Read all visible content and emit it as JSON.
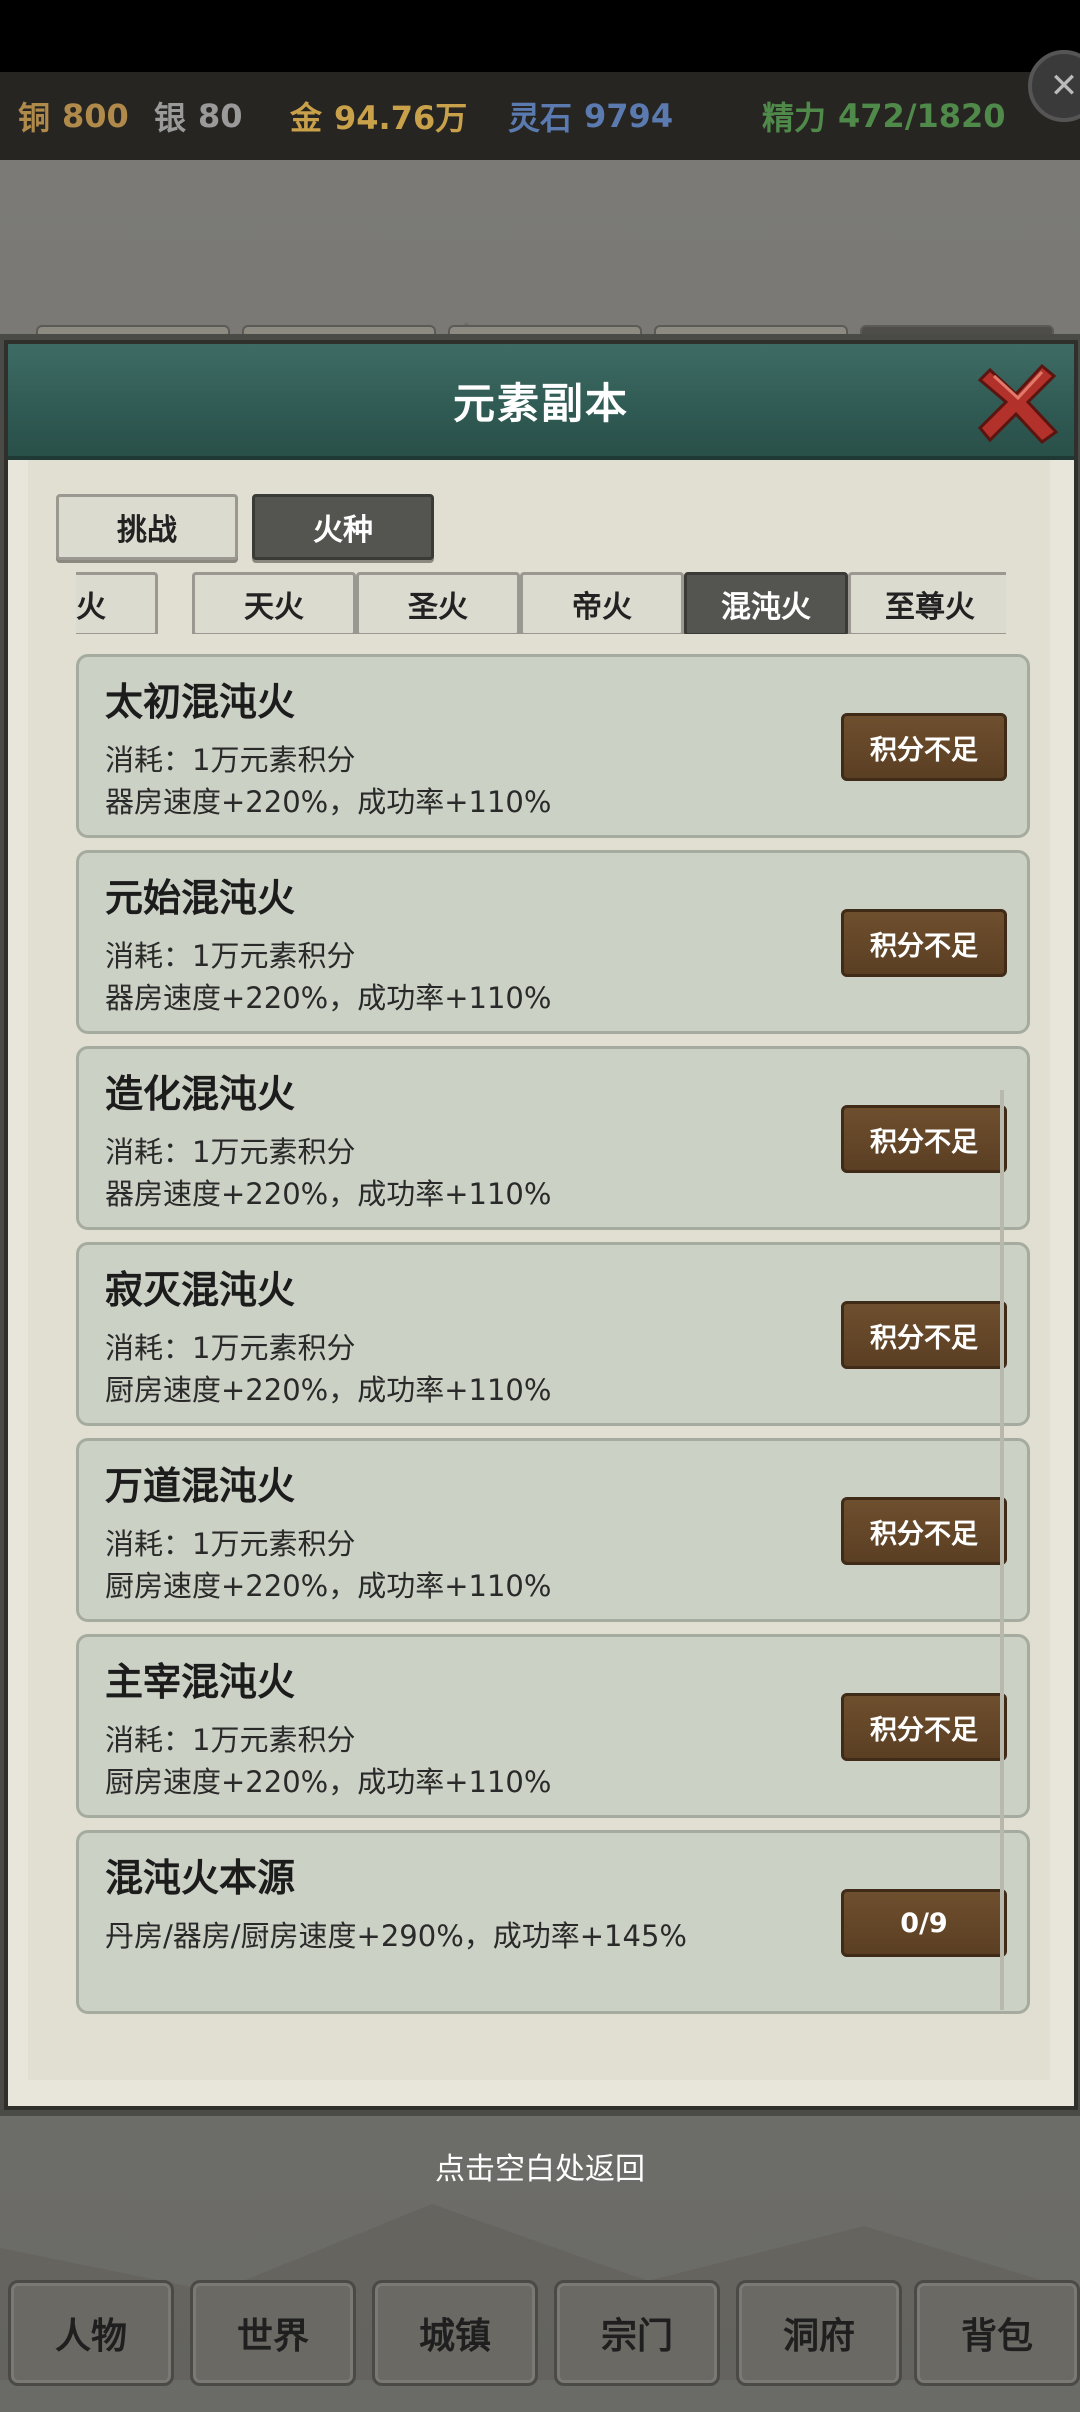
{
  "topbar": {
    "copper_label": "铜",
    "copper_value": "800",
    "silver_label": "银",
    "silver_value": "80",
    "gold_label": "金",
    "gold_value": "94.76万",
    "spirit_label": "灵石",
    "spirit_value": "9794",
    "energy_label": "精力",
    "energy_value": "472/1820"
  },
  "modal": {
    "title": "元素副本"
  },
  "content_tabs": [
    {
      "label": "挑战",
      "active": false
    },
    {
      "label": "火种",
      "active": true
    }
  ],
  "fire_tabs": [
    {
      "label": "地火",
      "active": false
    },
    {
      "label": "天火",
      "active": false
    },
    {
      "label": "圣火",
      "active": false
    },
    {
      "label": "帝火",
      "active": false
    },
    {
      "label": "混沌火",
      "active": true
    },
    {
      "label": "至尊火",
      "active": false
    }
  ],
  "items": [
    {
      "title": "太初混沌火",
      "line1": "消耗：1万元素积分",
      "line2": "器房速度+220%，成功率+110%",
      "button": "积分不足"
    },
    {
      "title": "元始混沌火",
      "line1": "消耗：1万元素积分",
      "line2": "器房速度+220%，成功率+110%",
      "button": "积分不足"
    },
    {
      "title": "造化混沌火",
      "line1": "消耗：1万元素积分",
      "line2": "器房速度+220%，成功率+110%",
      "button": "积分不足"
    },
    {
      "title": "寂灭混沌火",
      "line1": "消耗：1万元素积分",
      "line2": "厨房速度+220%，成功率+110%",
      "button": "积分不足"
    },
    {
      "title": "万道混沌火",
      "line1": "消耗：1万元素积分",
      "line2": "厨房速度+220%，成功率+110%",
      "button": "积分不足"
    },
    {
      "title": "主宰混沌火",
      "line1": "消耗：1万元素积分",
      "line2": "厨房速度+220%，成功率+110%",
      "button": "积分不足"
    },
    {
      "title": "混沌火本源",
      "line1": "丹房/器房/厨房速度+290%，成功率+145%",
      "line2": "",
      "button": "0/9"
    }
  ],
  "hint": "点击空白处返回",
  "bottom_nav": [
    "人物",
    "世界",
    "城镇",
    "宗门",
    "洞府",
    "背包"
  ],
  "colors": {
    "copper": "#b08a4a",
    "silver": "#9a9a9a",
    "gold": "#c9a14a",
    "spirit": "#5b7bb0",
    "energy": "#4f8a4a",
    "button": "#5e4226",
    "header": "#3a665e"
  }
}
